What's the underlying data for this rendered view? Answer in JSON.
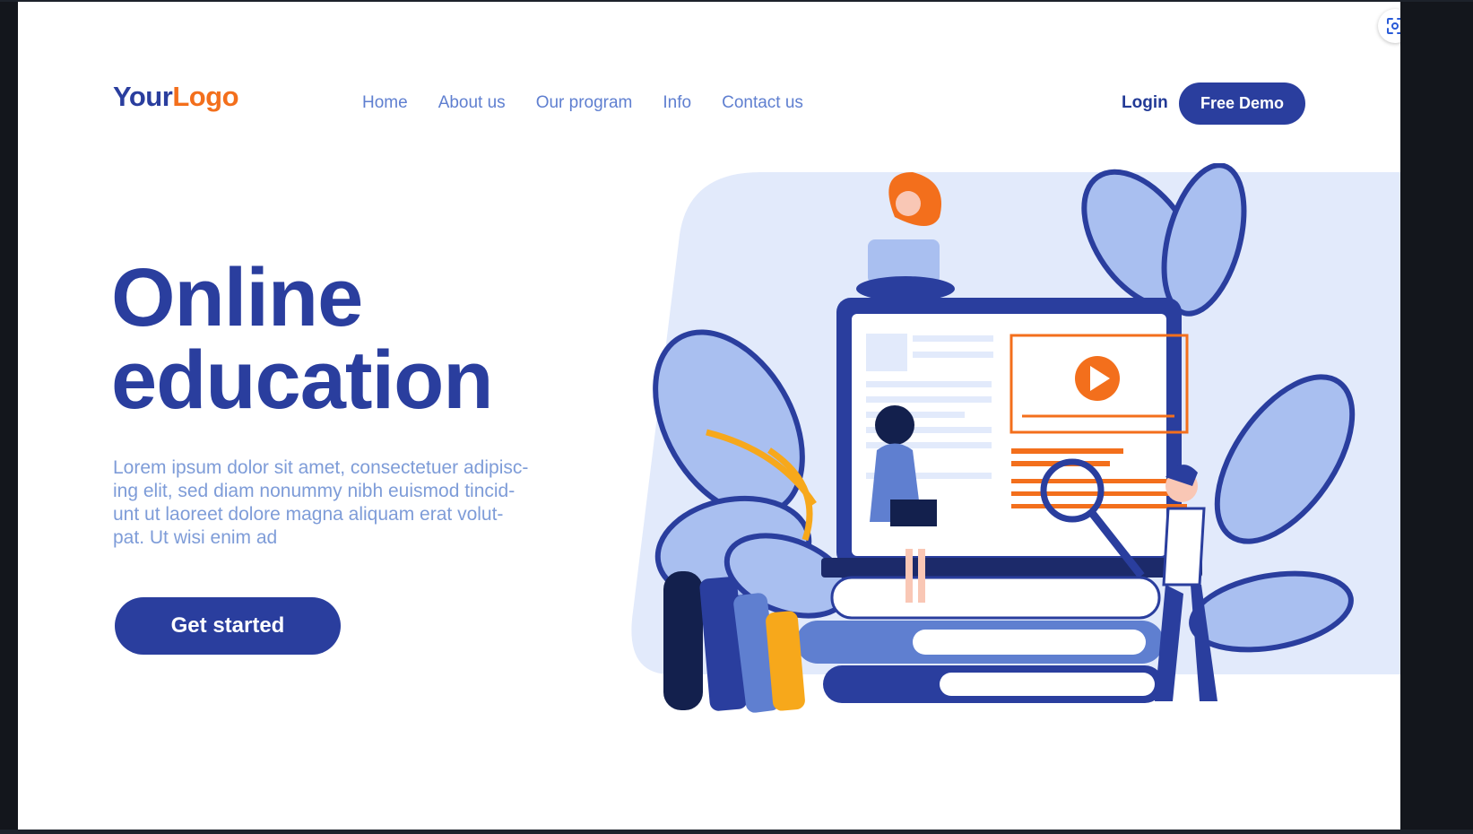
{
  "logo": {
    "part1": "Your",
    "part2": "Logo"
  },
  "nav": {
    "items": [
      {
        "label": "Home"
      },
      {
        "label": "About us"
      },
      {
        "label": "Our program"
      },
      {
        "label": "Info"
      },
      {
        "label": "Contact us"
      }
    ],
    "login_label": "Login",
    "demo_label": "Free Demo"
  },
  "hero": {
    "title_line1": "Online",
    "title_line2": "education",
    "description": "Lorem ipsum dolor sit amet, consectetuer adipisc-ing elit, sed diam nonummy nibh euismod tincid-unt ut laoreet dolore magna aliquam erat volut-pat. Ut wisi enim ad",
    "cta_label": "Get started"
  },
  "viewer": {
    "lens_icon": "lens-scan-icon"
  },
  "colors": {
    "brand_blue": "#2a3e9e",
    "accent_orange": "#f36f1c",
    "nav_blue": "#5f7fd0",
    "text_light_blue": "#7e9cd8",
    "illustration_bg": "#e2eafb",
    "leaf_blue": "#a9bff0",
    "yellow": "#f7a81b"
  },
  "illustration": {
    "icons": [
      "play-icon",
      "magnifier-icon",
      "laptop-icon",
      "books-icon",
      "leaf-icon"
    ]
  }
}
